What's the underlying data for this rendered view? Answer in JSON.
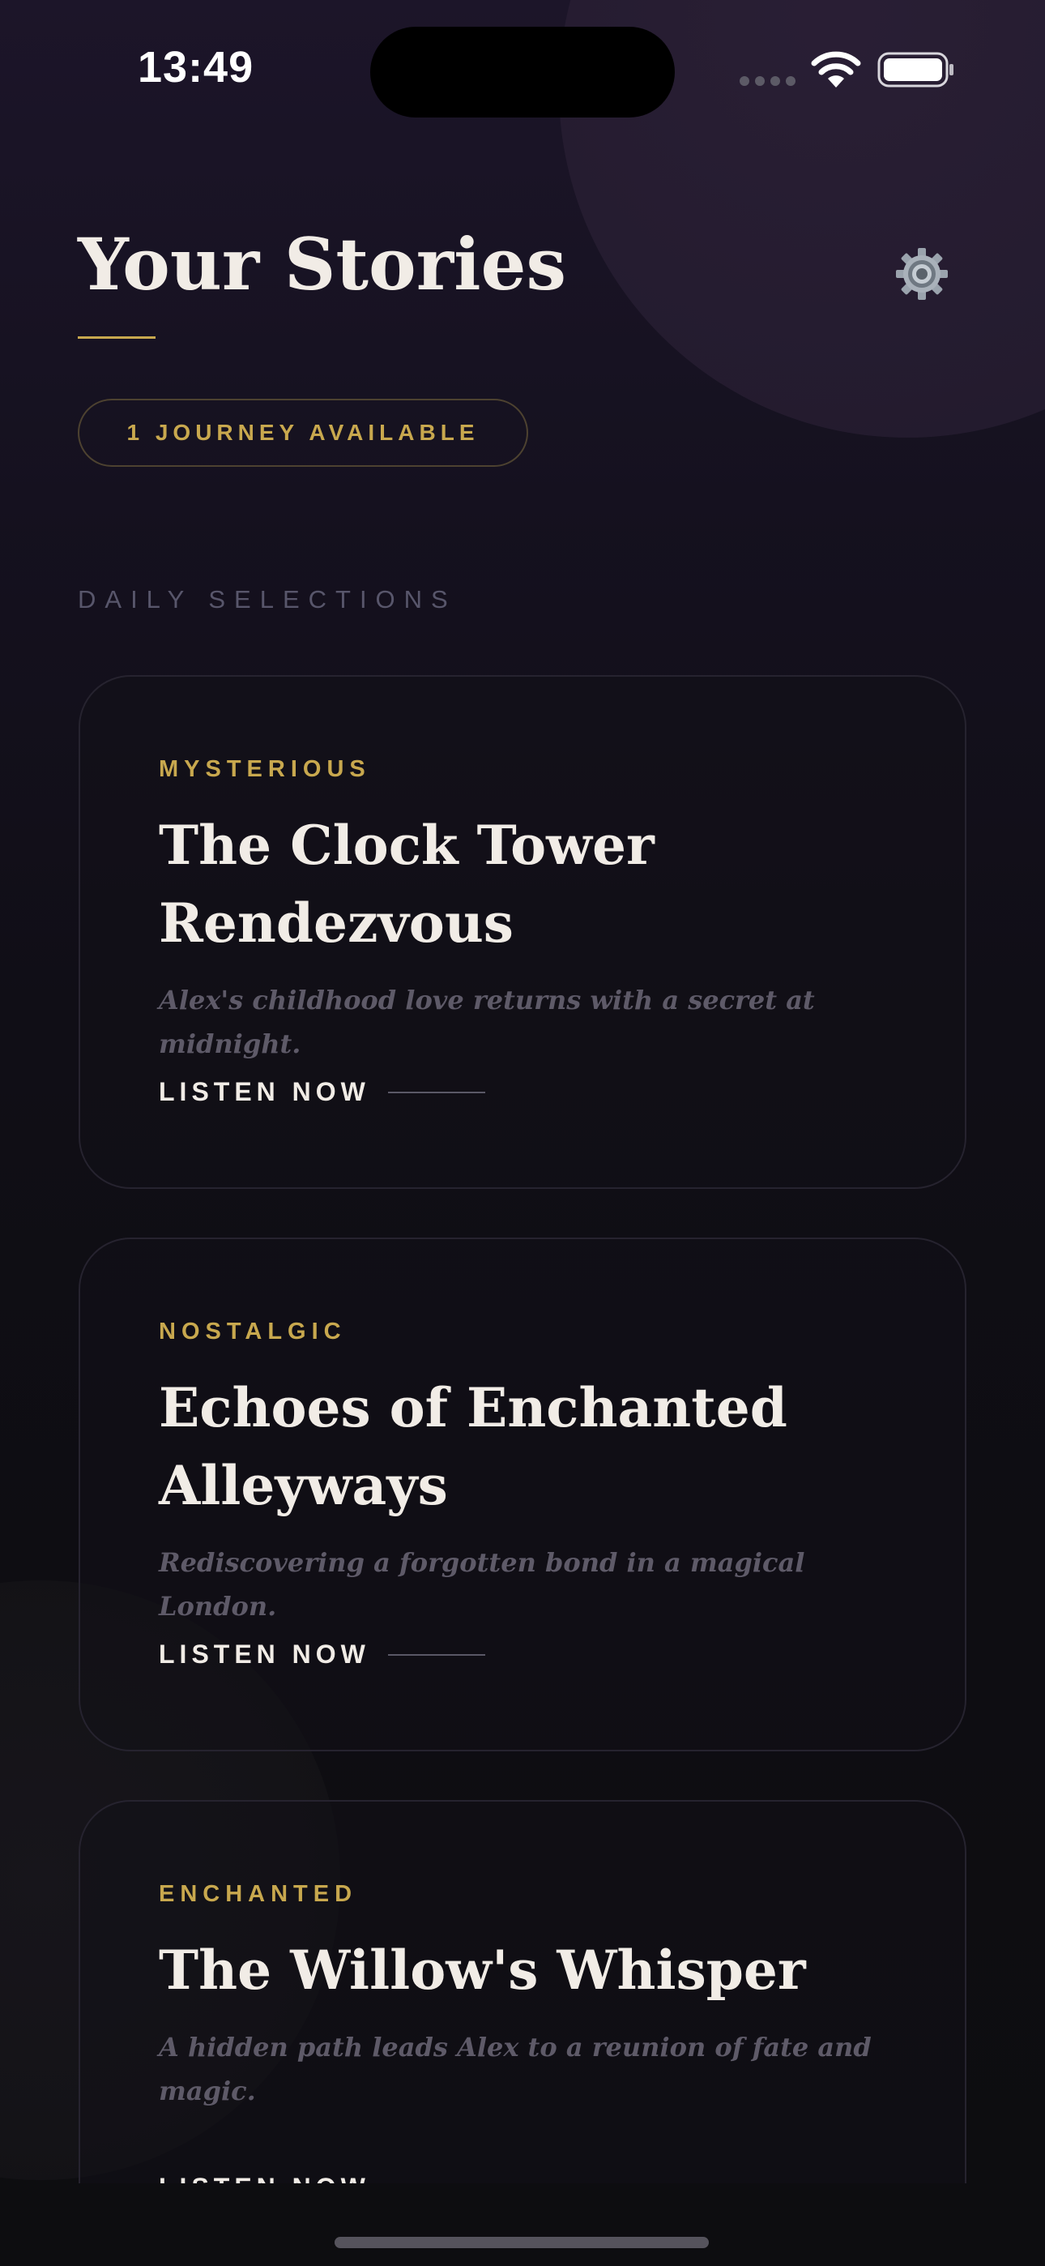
{
  "status_bar": {
    "time": "13:49"
  },
  "header": {
    "title": "Your Stories",
    "settings_icon": "gear-icon",
    "journeys_badge": "1 JOURNEY AVAILABLE"
  },
  "section": {
    "label": "DAILY SELECTIONS"
  },
  "stories": [
    {
      "mood": "MYSTERIOUS",
      "title": "The Clock Tower Rendezvous",
      "description": "Alex's childhood love returns with a secret at midnight.",
      "action": "LISTEN NOW"
    },
    {
      "mood": "NOSTALGIC",
      "title": "Echoes of Enchanted Alleyways",
      "description": "Rediscovering a forgotten bond in a magical London.",
      "action": "LISTEN NOW"
    },
    {
      "mood": "ENCHANTED",
      "title": "The Willow's Whisper",
      "description": "A hidden path leads Alex to a reunion of fate and magic.",
      "action": "LISTEN NOW"
    }
  ],
  "colors": {
    "accent_gold": "#c8a84e",
    "title_text": "#f1ece6",
    "muted_text": "#5e5a68",
    "background": "#0d0d10"
  }
}
